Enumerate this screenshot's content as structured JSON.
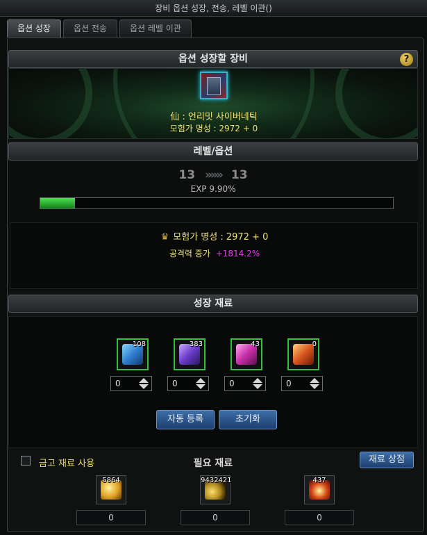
{
  "window": {
    "title": "장비 옵션 성장, 전송, 레벨 이관()"
  },
  "tabs": [
    {
      "label": "옵션 성장",
      "active": true
    },
    {
      "label": "옵션 전송",
      "active": false
    },
    {
      "label": "옵션 레벨 이관",
      "active": false
    }
  ],
  "equip": {
    "section_title": "옵션 성장할 장비",
    "help_icon": "?",
    "item_icon": "robot-armor-icon",
    "item_name": "仙 : 언리밋 사이버네틱",
    "fame": "모험가 명성 : 2972 + 0"
  },
  "level": {
    "section_title": "레벨/옵션",
    "from": "13",
    "arrows": "»»»",
    "to": "13",
    "exp_text": "EXP 9.90%",
    "exp_progress": 0.099,
    "fame_label": "모험가 명성 : 2972 + 0",
    "attack_label": "공격력 증가",
    "attack_value": "+1814.2%"
  },
  "materials": {
    "section_title": "성장 재료",
    "items": [
      {
        "icon": "blue-crystal-icon",
        "count": "108",
        "qty": "0",
        "color": "#2f7fd0"
      },
      {
        "icon": "purple-crystal-icon",
        "count": "383",
        "qty": "0",
        "color": "#6a3bc8"
      },
      {
        "icon": "pink-crystal-icon",
        "count": "43",
        "qty": "0",
        "color": "#c82ea8"
      },
      {
        "icon": "orange-crystal-icon",
        "count": "0",
        "qty": "0",
        "color": "#d8551e"
      }
    ],
    "auto_register_label": "자동 등록",
    "reset_label": "초기화"
  },
  "required": {
    "vault_checkbox_label": "금고 재료 사용",
    "title": "필요 재료",
    "shop_label": "재료 상점",
    "items": [
      {
        "icon": "gold-gem-icon",
        "count": "5864",
        "value": "0",
        "color": "#e0a020"
      },
      {
        "icon": "gold-coins-icon",
        "count": "9432421",
        "value": "0",
        "color": "#b08a20"
      },
      {
        "icon": "fire-orb-icon",
        "count": "437",
        "value": "0",
        "color": "#d84a18"
      }
    ]
  }
}
